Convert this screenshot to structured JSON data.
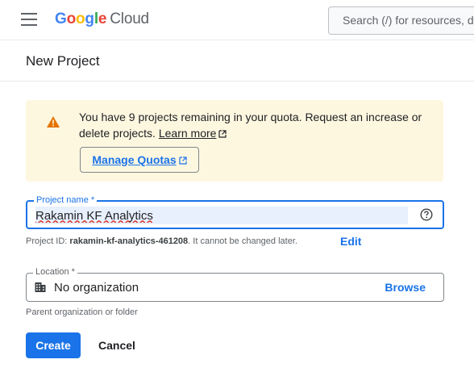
{
  "topbar": {
    "logo_letters": [
      {
        "ch": "G",
        "color": "#4285f4"
      },
      {
        "ch": "o",
        "color": "#ea4335"
      },
      {
        "ch": "o",
        "color": "#fbbc04"
      },
      {
        "ch": "g",
        "color": "#4285f4"
      },
      {
        "ch": "l",
        "color": "#34a853"
      },
      {
        "ch": "e",
        "color": "#ea4335"
      }
    ],
    "logo_product": "Cloud",
    "search_placeholder": "Search (/) for resources, d"
  },
  "page": {
    "title": "New Project"
  },
  "quota": {
    "text": "You have 9 projects remaining in your quota. Request an increase or delete projects.",
    "learn_more": "Learn more",
    "manage_label": "Manage Quotas",
    "icon": "warning-icon",
    "icon_color": "#e37400"
  },
  "project_name": {
    "label": "Project name *",
    "value": "Rakamin KF Analytics",
    "help_icon": "help-circle-icon"
  },
  "project_id": {
    "prefix": "Project ID:",
    "value": "rakamin-kf-analytics-461208",
    "suffix": ". It cannot be changed later.",
    "edit_label": "Edit"
  },
  "location": {
    "label": "Location *",
    "value": "No organization",
    "icon": "organization-icon",
    "browse_label": "Browse",
    "helper": "Parent organization or folder"
  },
  "actions": {
    "create_label": "Create",
    "cancel_label": "Cancel"
  },
  "colors": {
    "accent": "#1a73e8",
    "banner_bg": "#fef7e0"
  }
}
